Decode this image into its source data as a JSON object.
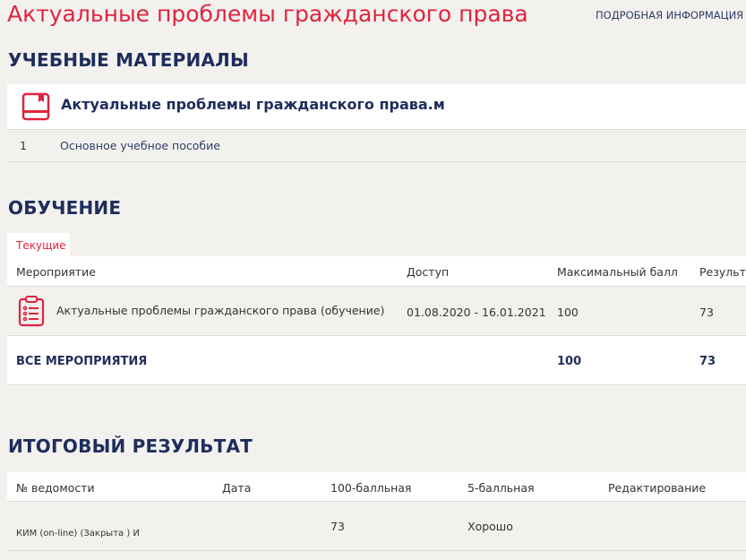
{
  "header": {
    "title": "Актуальные проблемы гражданского права",
    "info_link": "ПОДРОБНАЯ ИНФОРМАЦИЯ"
  },
  "materials": {
    "heading": "УЧЕБНЫЕ МАТЕРИАЛЫ",
    "card_title": "Актуальные проблемы гражданского права.м",
    "items": [
      {
        "num": "1",
        "label": "Основное учебное пособие"
      }
    ]
  },
  "training": {
    "heading": "ОБУЧЕНИЕ",
    "tab": "Текущие",
    "columns": [
      "Мероприятие",
      "Доступ",
      "Максимальный балл",
      "Результат"
    ],
    "rows": [
      {
        "name": "Актуальные проблемы гражданского права (обучение)",
        "access": "01.08.2020 - 16.01.2021",
        "max": "100",
        "result": "73"
      }
    ],
    "total": {
      "label": "ВСЕ МЕРОПРИЯТИЯ",
      "max": "100",
      "result": "73"
    }
  },
  "final": {
    "heading": "ИТОГОВЫЙ РЕЗУЛЬТАТ",
    "columns": [
      "№ ведомости",
      "Дата",
      "100-балльная",
      "5-балльная",
      "Редактирование"
    ],
    "rows": [
      {
        "sheet": "КИМ (on-line) (Закрыта ) И",
        "date": "",
        "score100": "73",
        "score5": "Хорошо",
        "edit": ""
      }
    ]
  },
  "colors": {
    "accent": "#e0243f",
    "navy": "#1f2d5c"
  }
}
